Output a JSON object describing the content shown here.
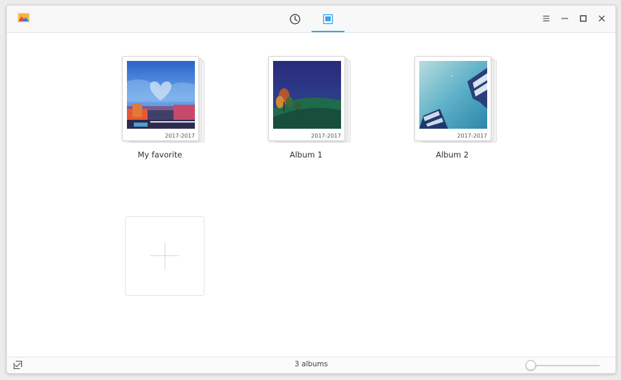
{
  "titlebar": {
    "app_icon": "deepin-album-logo-icon",
    "tabs": [
      {
        "icon": "clock-icon",
        "name": "timeline"
      },
      {
        "icon": "album-icon",
        "name": "albums",
        "active": true
      }
    ],
    "window_buttons": [
      "menu-icon",
      "minimize-icon",
      "maximize-icon",
      "close-icon"
    ],
    "accent_color": "#2ca7f8"
  },
  "albums": [
    {
      "name": "My favorite",
      "date_range": "2017-2017"
    },
    {
      "name": "Album 1",
      "date_range": "2017-2017"
    },
    {
      "name": "Album 2",
      "date_range": "2017-2017"
    }
  ],
  "add_album": {
    "icon": "plus-icon"
  },
  "statusbar": {
    "count_text": "3 albums",
    "import_icon": "import-icon",
    "zoom_level": 0
  }
}
